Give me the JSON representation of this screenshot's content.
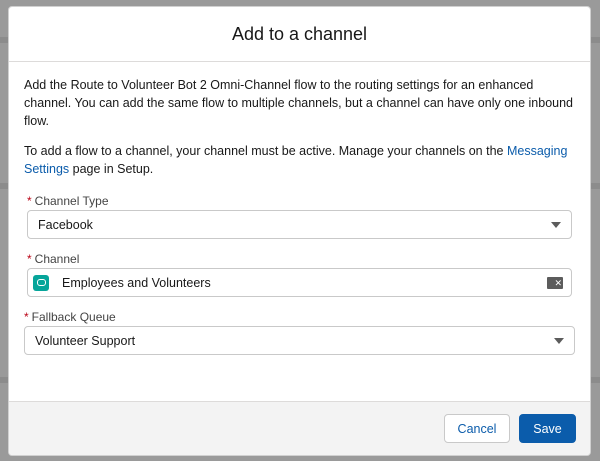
{
  "modal": {
    "title": "Add to a channel",
    "description": "Add the Route to Volunteer Bot 2 Omni-Channel flow to the routing settings for an enhanced channel. You can add the same flow to multiple channels, but a channel can have only one inbound flow.",
    "note_prefix": "To add a flow to a channel, your channel must be active. Manage your channels on the ",
    "note_link": "Messaging Settings",
    "note_suffix": " page in Setup."
  },
  "fields": {
    "required_marker": "*",
    "channel_type": {
      "label": "Channel Type",
      "value": "Facebook"
    },
    "channel": {
      "label": "Channel",
      "value": "Employees and Volunteers",
      "icon": "messaging-channel-icon"
    },
    "fallback_queue": {
      "label": "Fallback Queue",
      "value": "Volunteer Support"
    }
  },
  "footer": {
    "cancel_label": "Cancel",
    "save_label": "Save"
  },
  "colors": {
    "brand": "#0b5cab",
    "required": "#ba0517",
    "channel_icon": "#06a59a"
  }
}
